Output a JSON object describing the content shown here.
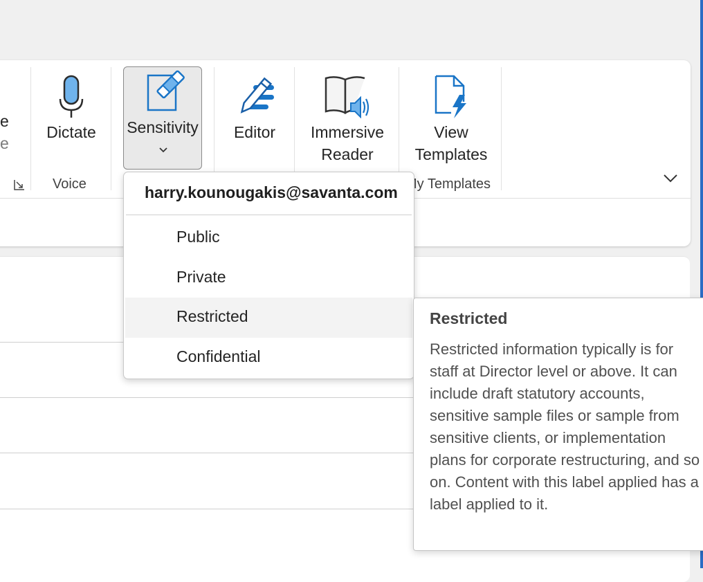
{
  "ribbon": {
    "partial_button_label": "e",
    "partial_button_label2": "e",
    "voice": {
      "dictate_label": "Dictate",
      "group_label": "Voice"
    },
    "sensitivity": {
      "label": "Sensitivity",
      "chevron": "⌄"
    },
    "editor": {
      "label": "Editor"
    },
    "immersive_reader": {
      "line1": "Immersive",
      "line2": "Reader"
    },
    "view_templates": {
      "line1": "View",
      "line2": "Templates",
      "group_label": "My Templates"
    },
    "collapse_icon": "chevron-down-icon",
    "dialog_launcher_icon": "dialog-launcher-icon"
  },
  "sensitivity_menu": {
    "account": "harry.kounougakis@savanta.com",
    "items": [
      {
        "label": "Public"
      },
      {
        "label": "Private"
      },
      {
        "label": "Restricted",
        "highlighted": true
      },
      {
        "label": "Confidential"
      }
    ]
  },
  "tooltip": {
    "title": "Restricted",
    "body": "Restricted information typically is for staff at Director level or above. It can include draft statutory accounts, sensitive sample files or sample from sensitive clients, or implementation plans for corporate restructuring, and so on. Content with this label applied has a label applied to it."
  },
  "colors": {
    "accent": "#2b6cc4",
    "icon_blue": "#1a75c7",
    "menu_hover": "#f3f3f3"
  }
}
